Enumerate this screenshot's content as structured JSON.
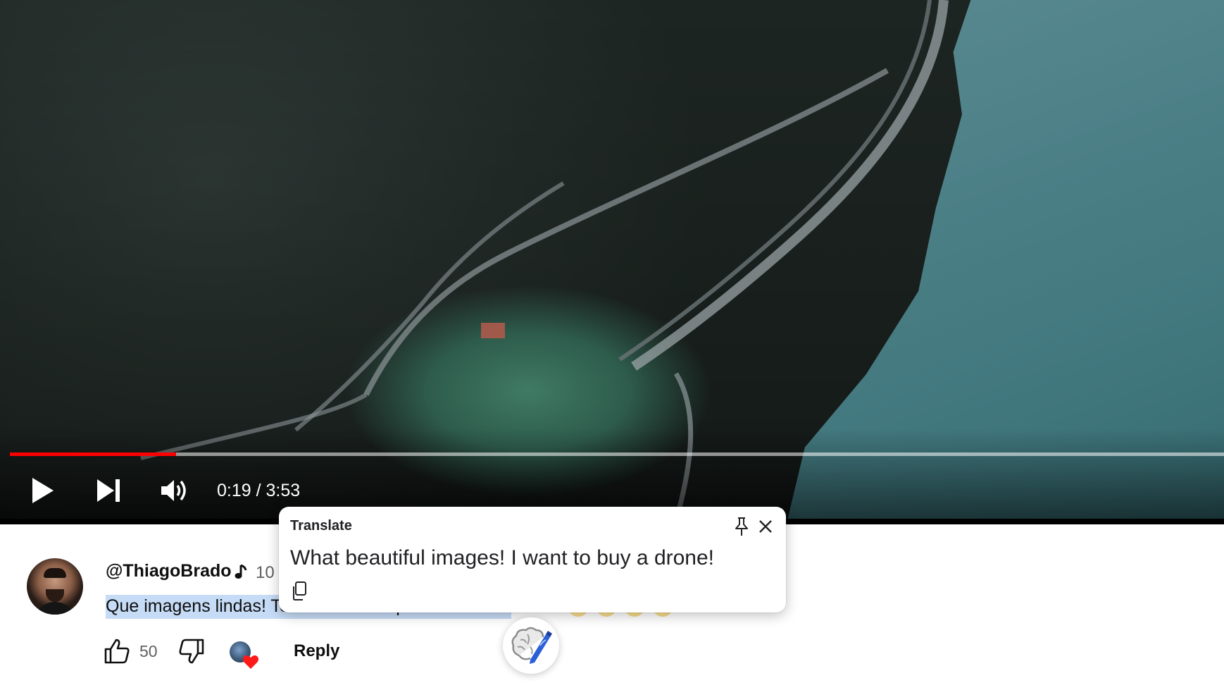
{
  "player": {
    "current_time": "0:19",
    "separator": " / ",
    "duration": "3:53",
    "progress_fraction": 0.137,
    "accent_color": "#ff0000"
  },
  "comment": {
    "author": "@ThiagoBrado",
    "time_ago": "10",
    "text_selected": "Que imagens lindas! Tentado de comprar um drone.",
    "like_count": "50",
    "reply_label": "Reply",
    "icons": {
      "like": "thumbs-up-icon",
      "dislike": "thumbs-down-icon",
      "creator_heart": "heart-icon",
      "music": "music-note-icon"
    }
  },
  "translate_popup": {
    "title": "Translate",
    "translation": "What beautiful images! I want to buy a drone!",
    "icons": {
      "pin": "pin-icon",
      "close": "close-icon",
      "copy": "copy-icon"
    }
  },
  "floating_button": {
    "icon": "brain-pencil-icon"
  }
}
